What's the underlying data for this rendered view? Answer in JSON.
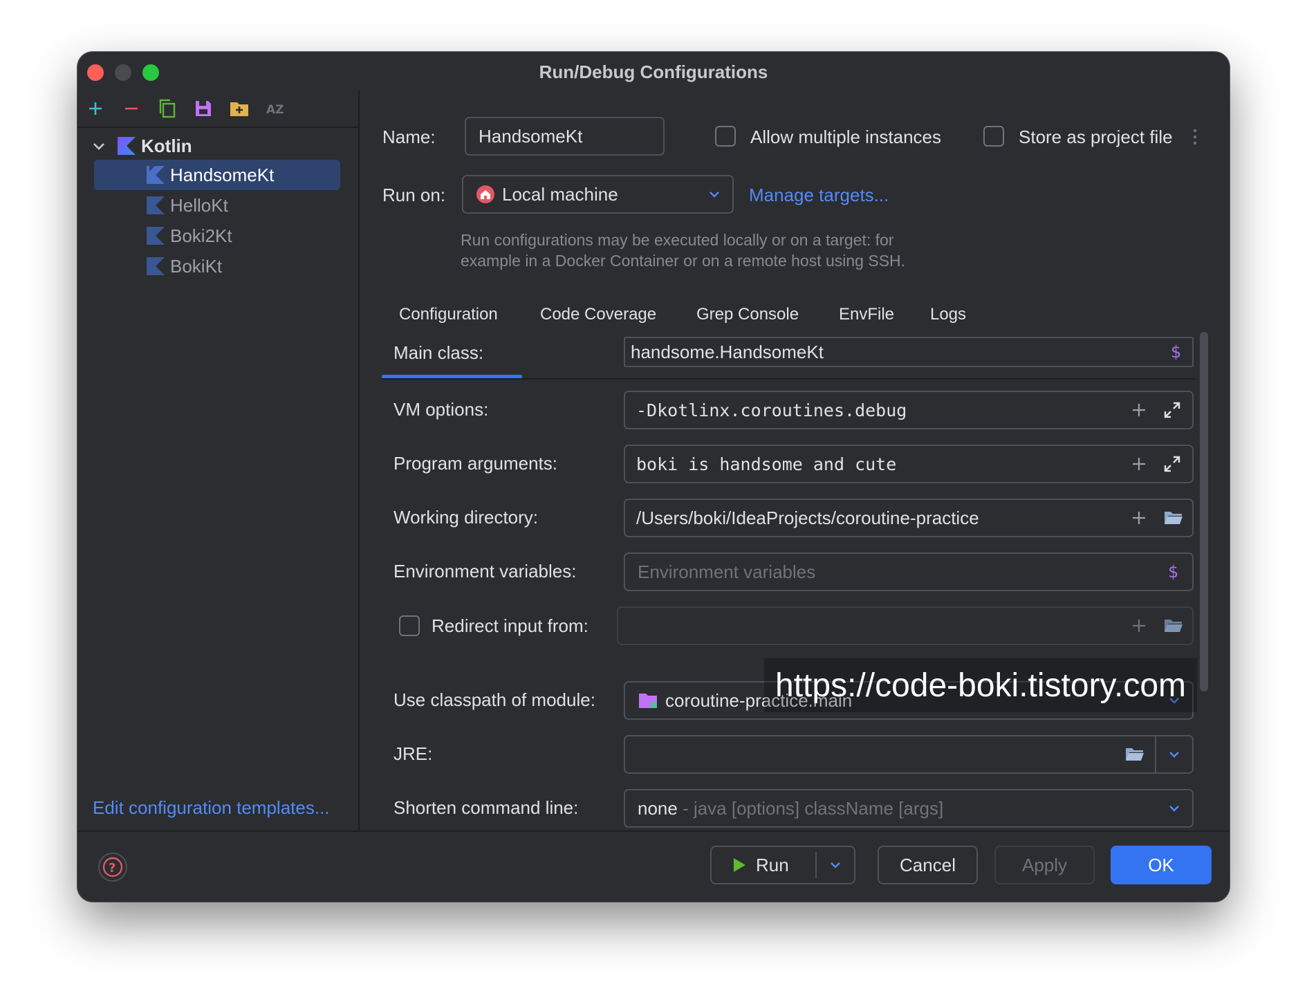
{
  "window": {
    "title": "Run/Debug Configurations"
  },
  "sidebar": {
    "group": "Kotlin",
    "items": [
      {
        "label": "HandsomeKt",
        "selected": true
      },
      {
        "label": "HelloKt"
      },
      {
        "label": "Boki2Kt"
      },
      {
        "label": "BokiKt"
      }
    ],
    "edit_templates": "Edit configuration templates..."
  },
  "form": {
    "name_label": "Name:",
    "name_value": "HandsomeKt",
    "allow_multiple": "Allow multiple instances",
    "store_as_project": "Store as project file",
    "run_on_label": "Run on:",
    "run_on_value": "Local machine",
    "manage_targets": "Manage targets...",
    "hint_line1": "Run configurations may be executed locally or on a target: for",
    "hint_line2": "example in a Docker Container or on a remote host using SSH."
  },
  "tabs": [
    "Configuration",
    "Code Coverage",
    "Grep Console",
    "EnvFile",
    "Logs"
  ],
  "config": {
    "main_class_label": "Main class:",
    "main_class_value": "handsome.HandsomeKt",
    "vm_options_label": "VM options:",
    "vm_options_value": "-Dkotlinx.coroutines.debug",
    "program_args_label": "Program arguments:",
    "program_args_value": "boki is handsome and cute",
    "working_dir_label": "Working directory:",
    "working_dir_value": "/Users/boki/IdeaProjects/coroutine-practice",
    "env_vars_label": "Environment variables:",
    "env_vars_placeholder": "Environment variables",
    "redirect_label": "Redirect input from:",
    "classpath_label": "Use classpath of module:",
    "classpath_value": "coroutine-practice.main",
    "jre_label": "JRE:",
    "shorten_label": "Shorten command line:",
    "shorten_value": "none",
    "shorten_hint": " - java [options] className [args]"
  },
  "watermark": "https://code-boki.tistory.com",
  "footer": {
    "run": "Run",
    "cancel": "Cancel",
    "apply": "Apply",
    "ok": "OK"
  },
  "colors": {
    "accent": "#3574f0",
    "link": "#548af7",
    "background": "#2b2d30",
    "selection": "#2e436e"
  }
}
